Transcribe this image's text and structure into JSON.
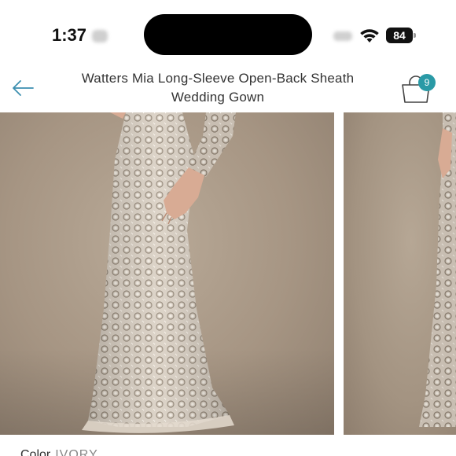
{
  "status_bar": {
    "time": "1:37",
    "battery": "84"
  },
  "header": {
    "title_line1": "Watters Mia Long-Sleeve Open-Back Sheath",
    "title_line2": "Wedding Gown",
    "cart_count": "9",
    "back_icon": "arrow-left-icon",
    "cart_icon": "shopping-bag-icon"
  },
  "gallery": {
    "images": [
      {
        "name": "gown-front-photo"
      },
      {
        "name": "gown-next-photo"
      }
    ]
  },
  "product": {
    "color_label": "Color",
    "color_value": "IVORY"
  },
  "colors": {
    "accent": "#2a9aa6",
    "back_arrow": "#3d8fb0",
    "photo_bg": "#a69583"
  }
}
